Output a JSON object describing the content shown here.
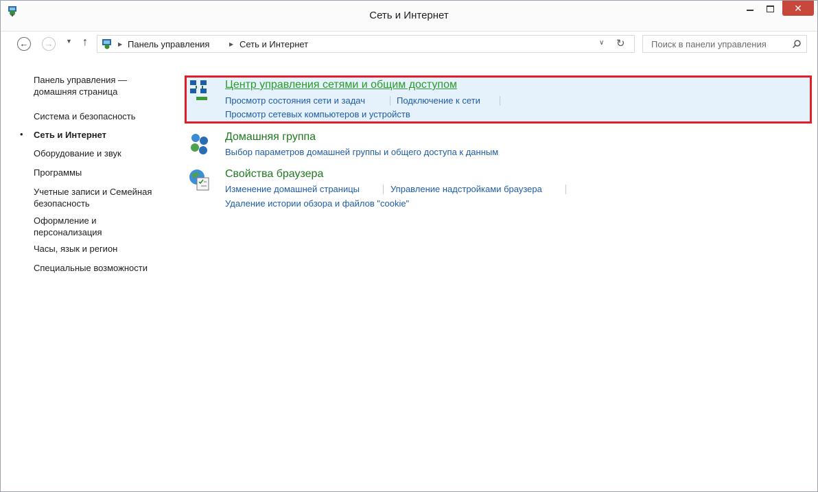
{
  "window": {
    "title": "Сеть и Интернет",
    "close_glyph": "✕"
  },
  "nav": {
    "back_glyph": "←",
    "forward_glyph": "→",
    "recent_glyph": "▼",
    "up_glyph": "↑",
    "breadcrumb": [
      "Панель управления",
      "Сеть и Интернет"
    ],
    "sep_glyph": "▶",
    "dropdown_glyph": "∨",
    "refresh_glyph": "↻",
    "search_placeholder": "Поиск в панели управления"
  },
  "sidebar": {
    "bullet": "•",
    "items": [
      "Панель управления — домашняя страница",
      "Система и безопасность",
      "Сеть и Интернет",
      "Оборудование и звук",
      "Программы",
      "Учетные записи и Семейная безопасность",
      "Оформление и персонализация",
      "Часы, язык и регион",
      "Специальные возможности"
    ],
    "active_index": 2
  },
  "categories": [
    {
      "title": "Центр управления сетями и общим доступом",
      "icon": "network-sharing-center-icon",
      "links": [
        "Просмотр состояния сети и задач",
        "Подключение к сети",
        "Просмотр сетевых компьютеров и устройств"
      ],
      "highlighted": true
    },
    {
      "title": "Домашняя группа",
      "icon": "homegroup-icon",
      "links": [
        "Выбор параметров домашней группы и общего доступа к данным"
      ]
    },
    {
      "title": "Свойства браузера",
      "icon": "internet-options-icon",
      "links": [
        "Изменение домашней страницы",
        "Управление надстройками браузера",
        "Удаление истории обзора и файлов \"cookie\""
      ]
    }
  ],
  "colors": {
    "highlight_border": "#e01e28",
    "highlight_bg": "#e5f1fb",
    "category_title": "#1e7a1e",
    "link": "#1e5ca8"
  }
}
